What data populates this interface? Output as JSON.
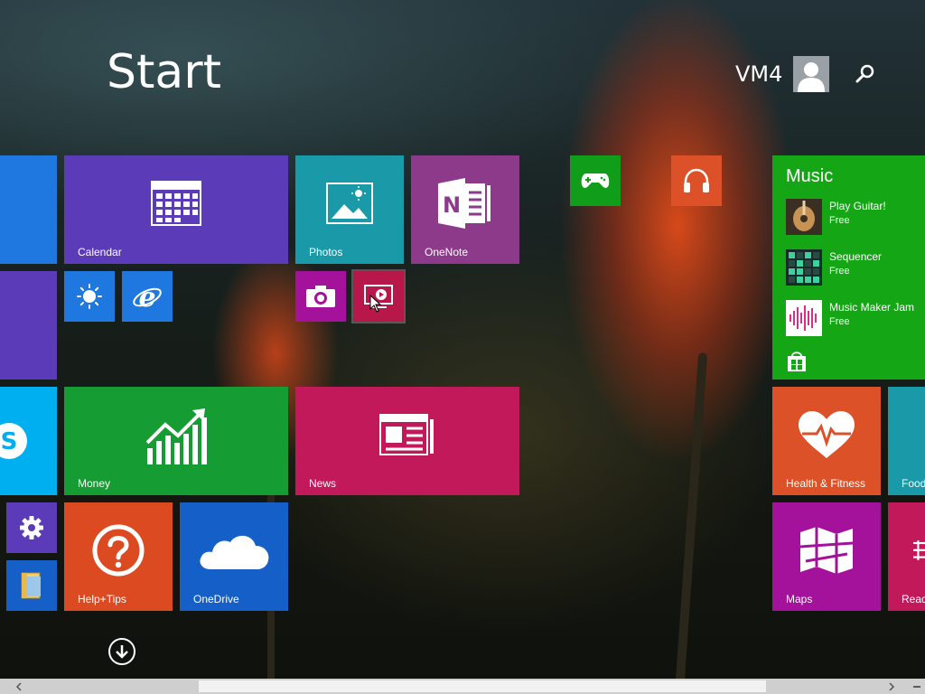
{
  "header": {
    "title": "Start",
    "user_name": "VM4"
  },
  "tiles": {
    "calendar": "Calendar",
    "photos": "Photos",
    "onenote": "OneNote",
    "money": "Money",
    "news": "News",
    "help": "Help+Tips",
    "onedrive": "OneDrive",
    "health": "Health & Fitness",
    "food": "Food",
    "maps": "Maps",
    "reading": "Read"
  },
  "music": {
    "title": "Music",
    "apps": [
      {
        "name": "Play Guitar!",
        "price": "Free"
      },
      {
        "name": "Sequencer",
        "price": "Free"
      },
      {
        "name": "Music Maker Jam",
        "price": "Free"
      }
    ]
  },
  "colors": {
    "purple": "#5b3bb8",
    "teal": "#1a9aa8",
    "onenote": "#8e3a8a",
    "green": "#0f9d1a",
    "money_green": "#159c32",
    "news": "#c2195a",
    "help": "#dc4a22",
    "onedrive": "#1560c8",
    "blue": "#1e78e0",
    "skype": "#00aff0",
    "health": "#dd5128",
    "maps": "#a4129b",
    "music": "#14a614"
  },
  "icons": {
    "calendar": "calendar-icon",
    "photos": "photos-icon",
    "onenote": "onenote-icon",
    "weather": "sun-icon",
    "ie": "internet-explorer-icon",
    "camera": "camera-icon",
    "video": "video-icon",
    "xbox": "xbox-controller-icon",
    "music": "headphones-icon",
    "money": "chart-up-icon",
    "news": "newspaper-icon",
    "help": "question-icon",
    "onedrive": "cloud-icon",
    "settings": "gear-icon",
    "explorer": "folder-icon",
    "health": "heart-pulse-icon",
    "maps": "map-icon",
    "store": "store-icon",
    "skype": "skype-icon",
    "search": "search-icon",
    "scroll_down": "arrow-down-icon"
  }
}
